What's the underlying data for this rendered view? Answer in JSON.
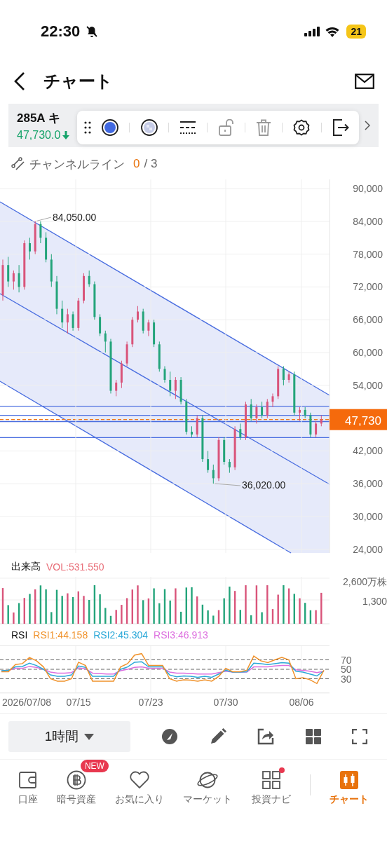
{
  "status_bar": {
    "time": "22:30",
    "battery": "21"
  },
  "header": {
    "title": "チャート"
  },
  "stock": {
    "name": "285A キ",
    "price": "47,730.0"
  },
  "tools": [
    {
      "kind": "handle",
      "disabled": false
    },
    {
      "kind": "color",
      "disabled": false
    },
    {
      "kind": "fill",
      "disabled": false
    },
    {
      "kind": "line-style",
      "disabled": false
    },
    {
      "kind": "lock",
      "disabled": true
    },
    {
      "kind": "delete",
      "disabled": true
    },
    {
      "kind": "settings",
      "disabled": false
    },
    {
      "kind": "exit",
      "disabled": false
    }
  ],
  "drawing": {
    "name": "チャンネルライン",
    "used": "0",
    "limit": "/ 3"
  },
  "price_chart": {
    "high_label": "84,050.00",
    "low_label": "36,020.00",
    "current_price": "47,730",
    "chart_data": {
      "type": "candlestick",
      "grid": true,
      "ylim": [
        23333,
        91667
      ],
      "yticks": [
        {
          "value": 90000,
          "label": "90,000"
        },
        {
          "value": 84000,
          "label": "84,000"
        },
        {
          "value": 78000,
          "label": "78,000"
        },
        {
          "value": 72000,
          "label": "72,000"
        },
        {
          "value": 66000,
          "label": "66,000"
        },
        {
          "value": 60000,
          "label": "60,000"
        },
        {
          "value": 54000,
          "label": "54,000"
        },
        {
          "value": 42000,
          "label": "42,000"
        },
        {
          "value": 36000,
          "label": "36,000"
        },
        {
          "value": 30000,
          "label": "30,000"
        },
        {
          "value": 24000,
          "label": "24,000"
        }
      ],
      "ohlc": [
        [
          70500,
          77000,
          69500,
          76000
        ],
        [
          76000,
          77500,
          72000,
          73000
        ],
        [
          73000,
          75000,
          71500,
          74500
        ],
        [
          74500,
          76000,
          71000,
          72000
        ],
        [
          72000,
          80500,
          71500,
          80000
        ],
        [
          80000,
          81000,
          77000,
          78500
        ],
        [
          78500,
          84050,
          78000,
          83500
        ],
        [
          83500,
          84000,
          80000,
          81000
        ],
        [
          81000,
          82000,
          76500,
          77000
        ],
        [
          77000,
          78000,
          72000,
          73000
        ],
        [
          73000,
          74000,
          67000,
          68000
        ],
        [
          68000,
          69500,
          64500,
          65500
        ],
        [
          65500,
          68000,
          63500,
          67000
        ],
        [
          67000,
          67500,
          64000,
          64500
        ],
        [
          64500,
          70000,
          64000,
          69500
        ],
        [
          69500,
          74500,
          69000,
          74000
        ],
        [
          74000,
          75000,
          72000,
          72500
        ],
        [
          72500,
          73000,
          66000,
          66500
        ],
        [
          66500,
          67000,
          63000,
          63500
        ],
        [
          63500,
          64000,
          60000,
          62000
        ],
        [
          62000,
          62500,
          52500,
          53000
        ],
        [
          53000,
          55000,
          52000,
          54500
        ],
        [
          54500,
          58500,
          53500,
          58000
        ],
        [
          58000,
          62000,
          57500,
          61500
        ],
        [
          61500,
          66500,
          61000,
          66000
        ],
        [
          66000,
          68500,
          65500,
          67500
        ],
        [
          67500,
          68000,
          63500,
          64000
        ],
        [
          64000,
          66000,
          63000,
          65500
        ],
        [
          65500,
          66000,
          61000,
          61500
        ],
        [
          61500,
          62000,
          56500,
          57000
        ],
        [
          57000,
          57500,
          54500,
          55000
        ],
        [
          55000,
          56500,
          52000,
          53000
        ],
        [
          53000,
          55500,
          51500,
          55000
        ],
        [
          55000,
          55500,
          50500,
          51000
        ],
        [
          51000,
          51500,
          45000,
          45500
        ],
        [
          45500,
          46500,
          44500,
          45000
        ],
        [
          45000,
          48500,
          44500,
          48000
        ],
        [
          48000,
          48500,
          40000,
          40500
        ],
        [
          40500,
          42000,
          38000,
          38500
        ],
        [
          38500,
          39500,
          36020,
          37000
        ],
        [
          37000,
          44500,
          36500,
          44000
        ],
        [
          44000,
          44500,
          39500,
          40000
        ],
        [
          40000,
          40500,
          38000,
          39000
        ],
        [
          39000,
          46500,
          38500,
          46000
        ],
        [
          46000,
          47000,
          44000,
          44500
        ],
        [
          44500,
          51000,
          44000,
          50500
        ],
        [
          50500,
          51500,
          47500,
          48000
        ],
        [
          48000,
          50500,
          47000,
          50000
        ],
        [
          50000,
          51000,
          48000,
          48500
        ],
        [
          48500,
          51500,
          48000,
          51000
        ],
        [
          51000,
          52500,
          50000,
          52000
        ],
        [
          52000,
          57500,
          51500,
          57000
        ],
        [
          57000,
          57500,
          54000,
          55000
        ],
        [
          55000,
          56500,
          54500,
          56000
        ],
        [
          56000,
          56500,
          48500,
          49000
        ],
        [
          49000,
          50000,
          47500,
          49500
        ],
        [
          49500,
          50000,
          48000,
          48500
        ],
        [
          48500,
          49000,
          44500,
          45000
        ],
        [
          45000,
          47500,
          44500,
          47000
        ],
        [
          47000,
          48500,
          46500,
          47730
        ]
      ]
    }
  },
  "volume": {
    "title": "出来高",
    "reading": "VOL:531.550",
    "y_axis": [
      "2,600万株",
      "1,300"
    ]
  },
  "rsi": {
    "title": "RSI",
    "readings": [
      "RSI1:44.158",
      "RSI2:45.304",
      "RSI3:46.913"
    ],
    "chart_data": {
      "type": "line",
      "grid": true,
      "ylim": [
        0,
        100
      ],
      "yticks": [
        70,
        50,
        30
      ],
      "series": [
        {
          "color": "#f0922b",
          "values": [
            45,
            45,
            60,
            62,
            75,
            68,
            55,
            30,
            25,
            25,
            30,
            65,
            58,
            25,
            25,
            25,
            25,
            55,
            62,
            80,
            83,
            58,
            58,
            58,
            30,
            25,
            28,
            27,
            25,
            28,
            25,
            35,
            52,
            45,
            45,
            48,
            78,
            68,
            64,
            70,
            75,
            70,
            30,
            32,
            28,
            20,
            48
          ]
        },
        {
          "color": "#2aa8d8",
          "values": [
            47,
            48,
            55,
            56,
            63,
            58,
            50,
            38,
            35,
            35,
            38,
            57,
            54,
            35,
            35,
            35,
            35,
            50,
            55,
            65,
            66,
            55,
            55,
            55,
            38,
            34,
            36,
            35,
            33,
            35,
            33,
            40,
            48,
            44,
            44,
            45,
            63,
            62,
            60,
            62,
            64,
            63,
            46,
            44,
            40,
            36,
            47
          ]
        },
        {
          "color": "#dd6fdf",
          "values": [
            47,
            48,
            52,
            52,
            56,
            54,
            50,
            44,
            42,
            42,
            43,
            53,
            51,
            42,
            41,
            40,
            40,
            47,
            50,
            54,
            55,
            52,
            52,
            52,
            44,
            42,
            42,
            41,
            40,
            40,
            40,
            43,
            46,
            44,
            44,
            44,
            55,
            55,
            55,
            57,
            58,
            58,
            49,
            48,
            46,
            43,
            46
          ]
        }
      ]
    }
  },
  "dates": [
    "2026/07/08",
    "07/15",
    "07/23",
    "07/30",
    "08/06"
  ],
  "interval": {
    "label": "1時間"
  },
  "tabs": [
    {
      "kind": "wallet",
      "label": "口座",
      "selected": false,
      "notification": false
    },
    {
      "kind": "coin",
      "label": "暗号資産",
      "selected": false,
      "badge": "NEW",
      "notification": false
    },
    {
      "kind": "heart",
      "label": "お気に入り",
      "selected": false,
      "notification": false
    },
    {
      "kind": "planet",
      "label": "マーケット",
      "selected": false,
      "notification": false
    },
    {
      "kind": "grid",
      "label": "投資ナビ",
      "selected": false,
      "notification": true
    },
    {
      "kind": "candle",
      "label": "チャート",
      "selected": true,
      "notification": false
    }
  ]
}
